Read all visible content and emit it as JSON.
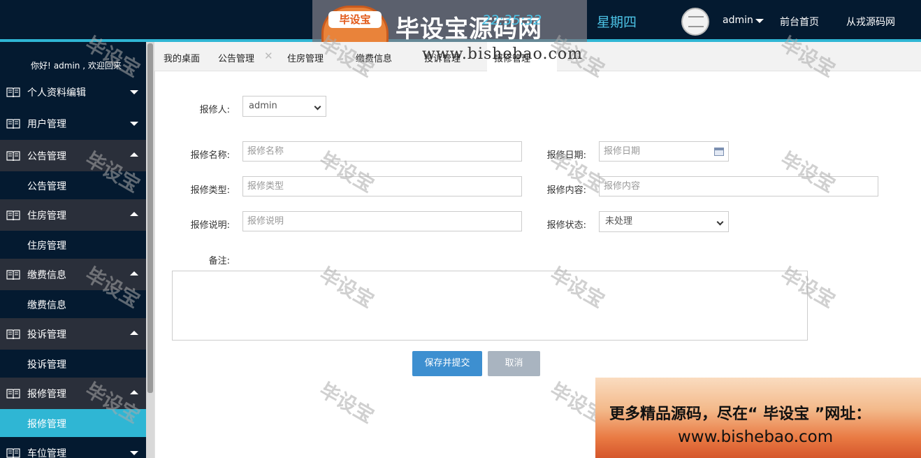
{
  "header": {
    "logo_tag": "毕设宝",
    "logo_text": "毕设宝源码网",
    "logo_url": "www.bishebao.com",
    "clock": "星期四 22:35:32",
    "clock_time": "22:35:32",
    "weekday": "星期四",
    "user": "admin",
    "links": [
      "前台首页",
      "从戎源码网"
    ]
  },
  "sidebar": {
    "greeting": [
      "你好!",
      "admin , 欢迎回来"
    ],
    "groups": [
      {
        "label": "个人资料编辑",
        "open": false
      },
      {
        "label": "用户管理",
        "open": false
      },
      {
        "label": "公告管理",
        "open": true,
        "sub": "公告管理"
      },
      {
        "label": "住房管理",
        "open": true,
        "sub": "住房管理"
      },
      {
        "label": "缴费信息",
        "open": true,
        "sub": "缴费信息"
      },
      {
        "label": "投诉管理",
        "open": true,
        "sub": "投诉管理"
      },
      {
        "label": "报修管理",
        "open": true,
        "sub": "报修管理"
      },
      {
        "label": "车位管理",
        "open": false
      }
    ]
  },
  "tabs": [
    "我的桌面",
    "公告管理",
    "住房管理",
    "缴费信息",
    "投诉管理",
    "报修管理"
  ],
  "form": {
    "reporter_label": "报修人:",
    "reporter_value": "admin",
    "name_label": "报修名称:",
    "name_placeholder": "报修名称",
    "date_label": "报修日期:",
    "date_placeholder": "报修日期",
    "type_label": "报修类型:",
    "type_placeholder": "报修类型",
    "content_label": "报修内容:",
    "content_placeholder": "报修内容",
    "desc_label": "报修说明:",
    "desc_placeholder": "报修说明",
    "status_label": "报修状态:",
    "status_value": "未处理",
    "remark_label": "备注:",
    "submit_label": "保存并提交",
    "cancel_label": "取消"
  },
  "watermark": "毕设宝",
  "banner": {
    "line1": "更多精品源码，尽在“ 毕设宝 ”网址：",
    "line2": "www.bishebao.com"
  },
  "colors": {
    "header_bg": "#041a30",
    "accent": "#2fb6d4",
    "primary_button": "#3d8fd0"
  }
}
